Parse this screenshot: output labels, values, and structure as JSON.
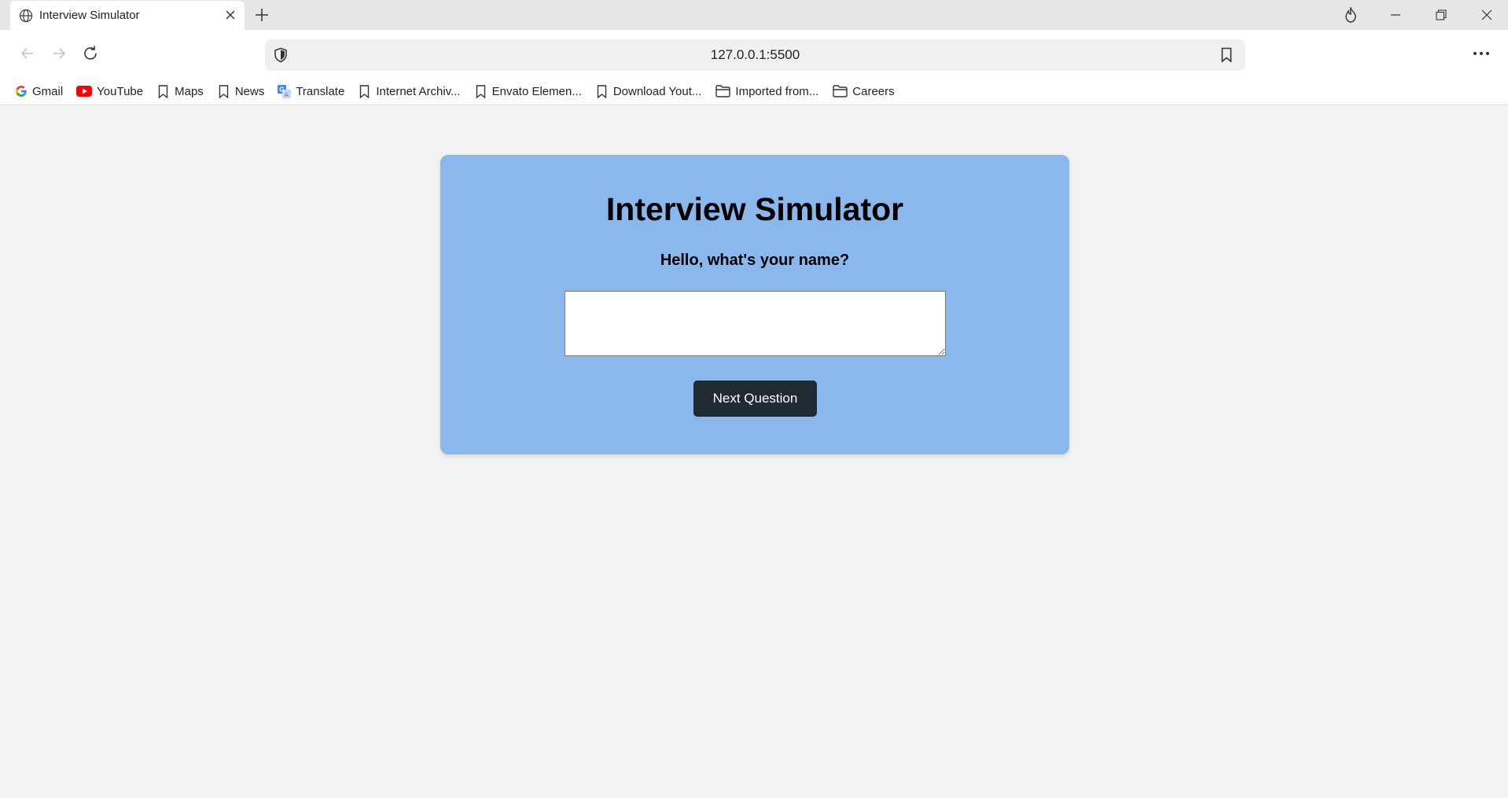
{
  "browser": {
    "tab": {
      "title": "Interview Simulator"
    },
    "address_bar": {
      "url": "127.0.0.1:5500"
    },
    "bookmarks": [
      {
        "label": "Gmail",
        "icon": "gmail-icon"
      },
      {
        "label": "YouTube",
        "icon": "youtube-icon"
      },
      {
        "label": "Maps",
        "icon": "bookmark-icon"
      },
      {
        "label": "News",
        "icon": "bookmark-icon"
      },
      {
        "label": "Translate",
        "icon": "translate-icon"
      },
      {
        "label": "Internet Archiv...",
        "icon": "bookmark-icon"
      },
      {
        "label": "Envato Elemen...",
        "icon": "bookmark-icon"
      },
      {
        "label": "Download Yout...",
        "icon": "bookmark-icon"
      },
      {
        "label": "Imported from...",
        "icon": "folder-icon"
      },
      {
        "label": "Careers",
        "icon": "folder-icon"
      }
    ]
  },
  "page": {
    "title": "Interview Simulator",
    "question": "Hello, what's your name?",
    "answer": {
      "value": "",
      "placeholder": ""
    },
    "next_button_label": "Next Question"
  },
  "colors": {
    "card_background": "#8ab8ed",
    "button_background": "#1f2a33",
    "page_background": "#f3f3f3"
  }
}
